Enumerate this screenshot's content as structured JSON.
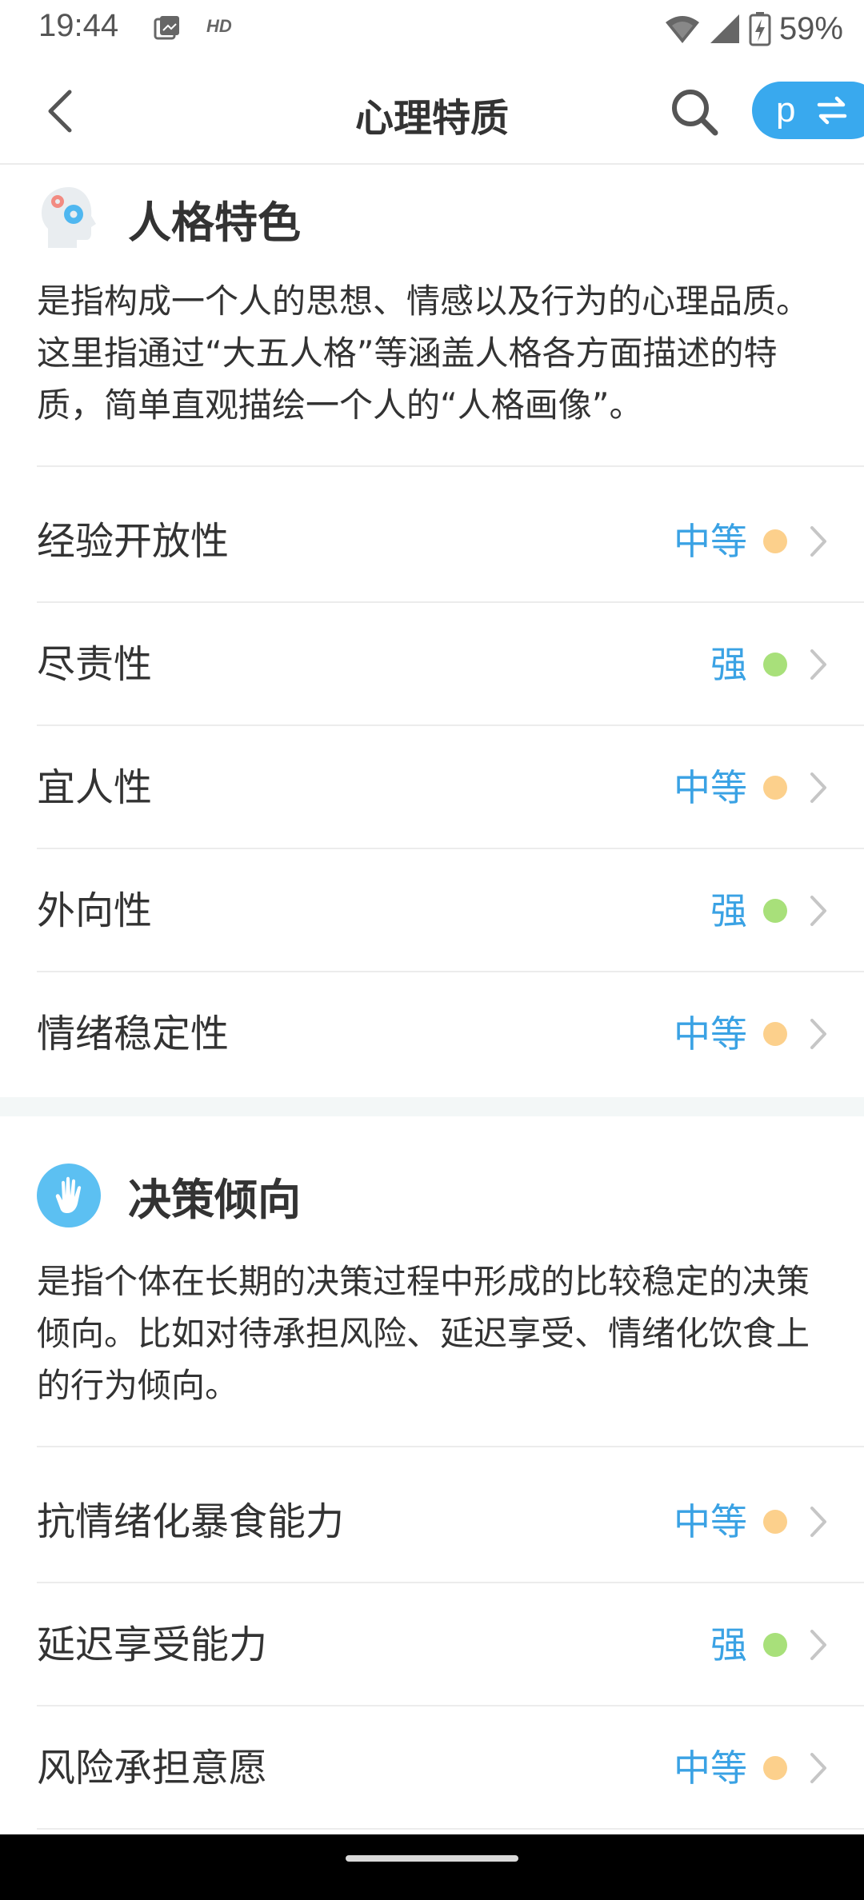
{
  "status_bar": {
    "time": "19:44",
    "hd": "HD",
    "battery": "59%"
  },
  "nav": {
    "title": "心理特质",
    "switch_letter": "p",
    "icons": [
      "chevron-left-icon",
      "search-icon",
      "swap-arrows-icon"
    ]
  },
  "sections": [
    {
      "title": "人格特色",
      "icon": "head-gears-icon",
      "description": "是指构成一个人的思想、情感以及行为的心理品质。这里指通过“大五人格”等涵盖人格各方面描述的特质，简单直观描绘一个人的“人格画像”。",
      "items": [
        {
          "label": "经验开放性",
          "value": "中等",
          "dot": "orange"
        },
        {
          "label": "尽责性",
          "value": "强",
          "dot": "green"
        },
        {
          "label": "宜人性",
          "value": "中等",
          "dot": "orange"
        },
        {
          "label": "外向性",
          "value": "强",
          "dot": "green"
        },
        {
          "label": "情绪稳定性",
          "value": "中等",
          "dot": "orange"
        }
      ]
    },
    {
      "title": "决策倾向",
      "icon": "raised-hand-icon",
      "description": "是指个体在长期的决策过程中形成的比较稳定的决策倾向。比如对待承担风险、延迟享受、情绪化饮食上的行为倾向。",
      "items": [
        {
          "label": "抗情绪化暴食能力",
          "value": "中等",
          "dot": "orange"
        },
        {
          "label": "延迟享受能力",
          "value": "强",
          "dot": "green"
        },
        {
          "label": "风险承担意愿",
          "value": "中等",
          "dot": "orange"
        }
      ]
    }
  ],
  "colors": {
    "accent": "#39a9ee",
    "value_text": "#3aa2e4",
    "orange": "#fcd08c",
    "green": "#a8e07a"
  }
}
